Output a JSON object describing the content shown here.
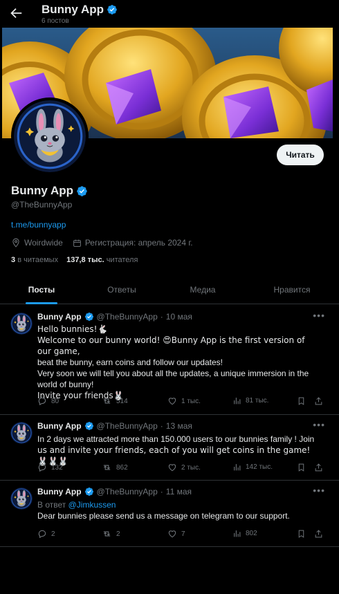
{
  "header": {
    "title": "Bunny App",
    "post_count": "6 постов"
  },
  "profile": {
    "name": "Bunny App",
    "handle": "@TheBunnyApp",
    "url": "t.me/bunnyapp",
    "location": "Woirdwide",
    "joined": "Регистрация: апрель 2024 г.",
    "following_count": "3",
    "following_label": "в читаемых",
    "followers_count": "137,8 тыс.",
    "followers_label": "читателя",
    "follow_button": "Читать"
  },
  "tabs": [
    {
      "label": "Посты"
    },
    {
      "label": "Ответы"
    },
    {
      "label": "Медиа"
    },
    {
      "label": "Нравится"
    }
  ],
  "tweets": [
    {
      "name": "Bunny App",
      "handle": "@TheBunnyApp",
      "sep": "·",
      "date": "10 мая",
      "lines": [
        "Hello bunnies!🐇",
        "Welcome to our bunny world! 😍Bunny App is the first version of our game,",
        "beat the bunny, earn coins and follow our updates!",
        "Very soon we will tell you about all the updates, a unique immersion in the",
        "world of bunny!",
        "Invite your friends🐰"
      ],
      "replies": "80",
      "retweets": "514",
      "likes": "1 тыс.",
      "views": "81 тыс."
    },
    {
      "name": "Bunny App",
      "handle": "@TheBunnyApp",
      "sep": "·",
      "date": "13 мая",
      "lines": [
        "In 2 days we attracted more than 150.000 users to our bunnies family ! Join",
        "us and invite your friends, each of you will get coins in the game! 🐰🐰🐰"
      ],
      "replies": "132",
      "retweets": "862",
      "likes": "2 тыс.",
      "views": "142 тыс."
    },
    {
      "name": "Bunny App",
      "handle": "@TheBunnyApp",
      "sep": "·",
      "date": "11 мая",
      "reply_prefix": "В ответ",
      "reply_to": "@Jimkussen",
      "lines": [
        "Dear bunnies please send us a message on telegram to our support."
      ],
      "replies": "2",
      "retweets": "2",
      "likes": "7",
      "views": "802"
    }
  ],
  "colors": {
    "accent": "#1d9bf0",
    "verified": "#1d9bf0",
    "muted": "#71767b",
    "border": "#2f3336",
    "background": "#000000"
  },
  "icons": [
    "back-arrow-icon",
    "verified-badge-icon",
    "location-icon",
    "calendar-icon",
    "more-icon",
    "reply-icon",
    "retweet-icon",
    "like-icon",
    "views-icon",
    "bookmark-icon",
    "share-icon"
  ]
}
